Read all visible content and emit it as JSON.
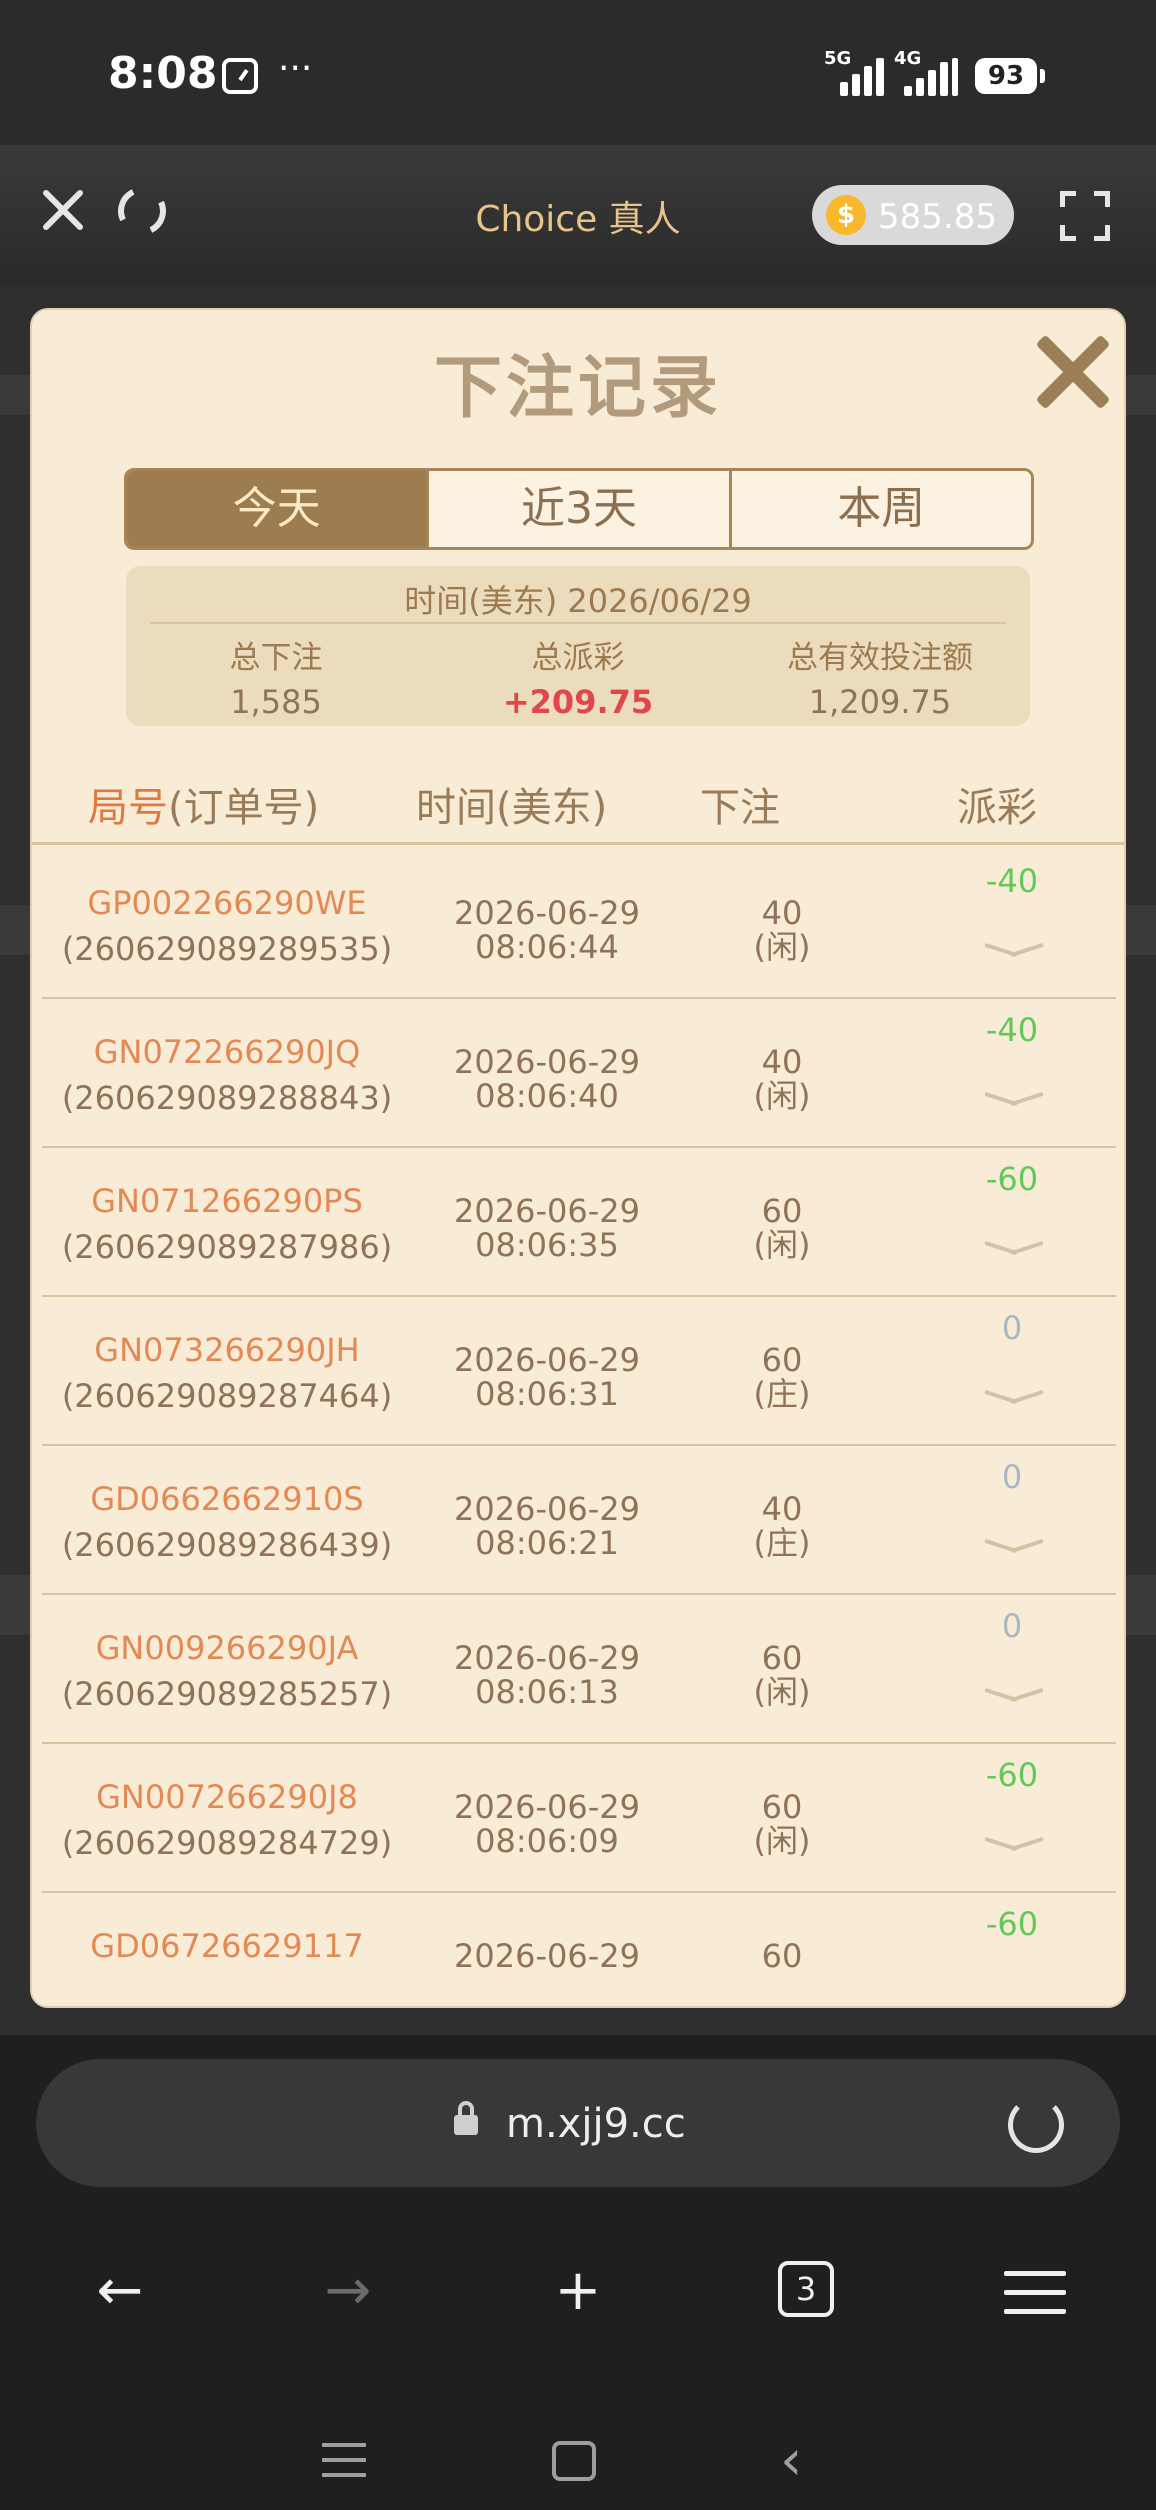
{
  "status_bar": {
    "time": "8:08",
    "dots": "···",
    "net1": "5G",
    "net2": "4G",
    "battery": "93"
  },
  "app_bar": {
    "title": "Choice 真人",
    "balance": "585.85",
    "coin_symbol": "$"
  },
  "modal": {
    "title": "下注记录",
    "tabs": [
      {
        "label": "今天",
        "active": true
      },
      {
        "label": "近3天",
        "active": false
      },
      {
        "label": "本周",
        "active": false
      }
    ],
    "summary": {
      "date_label": "时间(美东) 2026/06/29",
      "total_bet_label": "总下注",
      "total_bet": "1,585",
      "total_payout_label": "总派彩",
      "total_payout": "+209.75",
      "valid_bet_label": "总有效投注额",
      "valid_bet": "1,209.75"
    },
    "columns": {
      "id_prefix": "局号",
      "id_suffix": "(订单号)",
      "time": "时间(美东)",
      "bet": "下注",
      "payout": "派彩"
    },
    "rows": [
      {
        "game": "GP002266290WE",
        "order": "(260629089289535)",
        "date": "2026-06-29",
        "time": "08:06:44",
        "amount": "40",
        "side": "(闲)",
        "payout": "-40"
      },
      {
        "game": "GN072266290JQ",
        "order": "(260629089288843)",
        "date": "2026-06-29",
        "time": "08:06:40",
        "amount": "40",
        "side": "(闲)",
        "payout": "-40"
      },
      {
        "game": "GN071266290PS",
        "order": "(260629089287986)",
        "date": "2026-06-29",
        "time": "08:06:35",
        "amount": "60",
        "side": "(闲)",
        "payout": "-60"
      },
      {
        "game": "GN073266290JH",
        "order": "(260629089287464)",
        "date": "2026-06-29",
        "time": "08:06:31",
        "amount": "60",
        "side": "(庄)",
        "payout": "0"
      },
      {
        "game": "GD0662662910S",
        "order": "(260629089286439)",
        "date": "2026-06-29",
        "time": "08:06:21",
        "amount": "40",
        "side": "(庄)",
        "payout": "0"
      },
      {
        "game": "GN009266290JA",
        "order": "(260629089285257)",
        "date": "2026-06-29",
        "time": "08:06:13",
        "amount": "60",
        "side": "(闲)",
        "payout": "0"
      },
      {
        "game": "GN007266290J8",
        "order": "(260629089284729)",
        "date": "2026-06-29",
        "time": "08:06:09",
        "amount": "60",
        "side": "(闲)",
        "payout": "-60"
      },
      {
        "game": "GD06726629117",
        "order": "",
        "date": "2026-06-29",
        "time": "",
        "amount": "60",
        "side": "",
        "payout": "-60"
      }
    ],
    "colors": {
      "negative": "#63c85a",
      "zero": "#a9b7c4"
    }
  },
  "browser": {
    "url": "m.xjj9.cc",
    "tab_count": "3"
  }
}
